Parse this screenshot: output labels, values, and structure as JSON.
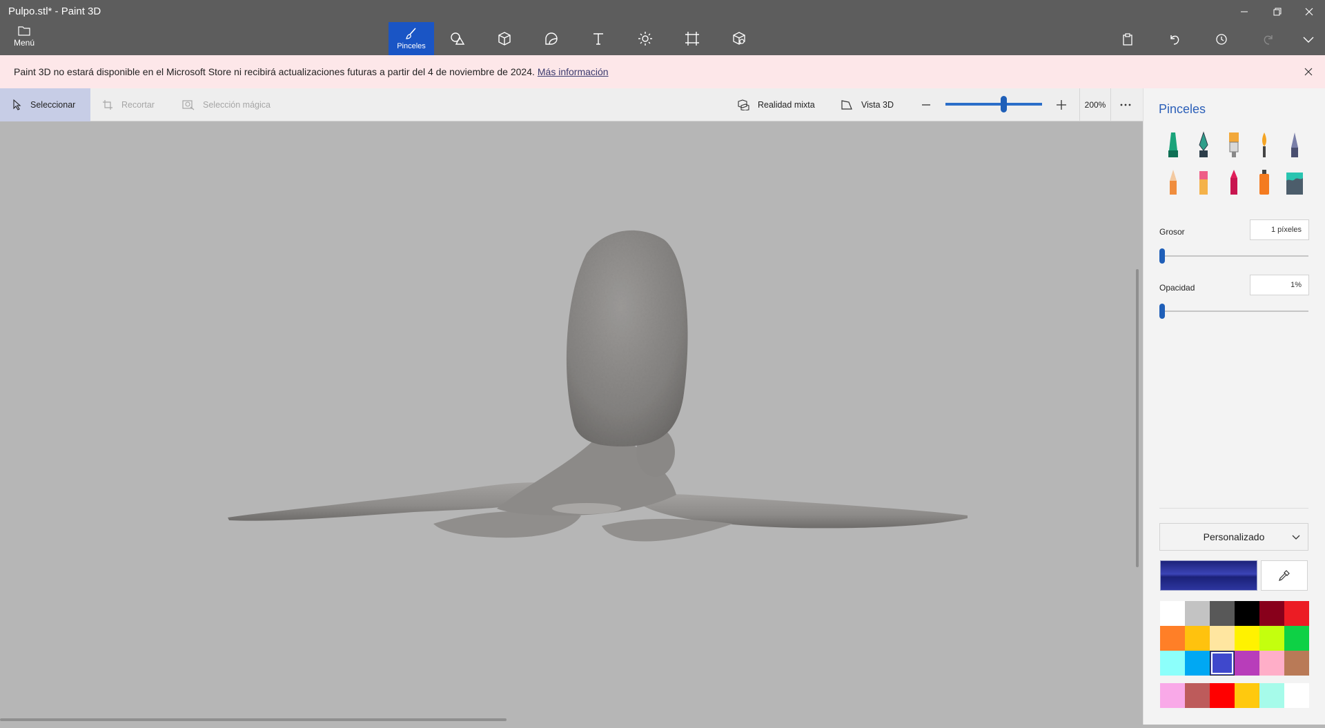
{
  "window": {
    "title": "Pulpo.stl* - Paint 3D"
  },
  "menu": {
    "label": "Menú"
  },
  "tools": [
    {
      "id": "brushes",
      "label": "Pinceles",
      "icon": "brush-icon",
      "active": true
    },
    {
      "id": "shapes2d",
      "label": "",
      "icon": "shapes-2d-icon"
    },
    {
      "id": "shapes3d",
      "label": "",
      "icon": "cube-3d-icon"
    },
    {
      "id": "stickers",
      "label": "",
      "icon": "sticker-icon"
    },
    {
      "id": "text",
      "label": "",
      "icon": "text-icon"
    },
    {
      "id": "effects",
      "label": "",
      "icon": "effects-sun-icon"
    },
    {
      "id": "canvas",
      "label": "",
      "icon": "canvas-crop-icon"
    },
    {
      "id": "library3d",
      "label": "",
      "icon": "3d-library-icon"
    }
  ],
  "banner": {
    "text": "Paint 3D no estará disponible en el Microsoft Store ni recibirá actualizaciones futuras a partir del 4 de noviembre de 2024.",
    "link": "Más información"
  },
  "subtoolbar": {
    "select": "Seleccionar",
    "crop": "Recortar",
    "magic_select": "Selección mágica",
    "mixed_reality": "Realidad mixta",
    "view3d": "Vista 3D",
    "zoom": "200%",
    "zoom_level": 0.6
  },
  "panel": {
    "title": "Pinceles",
    "brushes": [
      "marker-icon",
      "calligraphy-pen-icon",
      "oil-brush-icon",
      "watercolor-icon",
      "pixel-pen-icon",
      "pencil-icon",
      "eraser-icon",
      "crayon-icon",
      "spray-can-icon",
      "fill-bucket-icon"
    ],
    "thickness_label": "Grosor",
    "thickness_value": "1 píxeles",
    "opacity_label": "Opacidad",
    "opacity_value": "1%",
    "texture": "Personalizado",
    "current_color": "#2b3299",
    "palette": [
      "#ffffff",
      "#c3c3c3",
      "#585858",
      "#000000",
      "#88001b",
      "#ec1c24",
      "#ff7f27",
      "#ffc20e",
      "#ffe6a0",
      "#fff200",
      "#c4ff0e",
      "#0ed145",
      "#8cfffb",
      "#00a8f3",
      "#3f48cc",
      "#b83dba",
      "#ffaec8",
      "#b97a57"
    ],
    "custom_palette": [
      "#f9a9e8",
      "#bd5b5b",
      "#ff0000",
      "#ffc90e",
      "#a6fbea",
      "#ffffff"
    ],
    "selected_index": 14
  }
}
